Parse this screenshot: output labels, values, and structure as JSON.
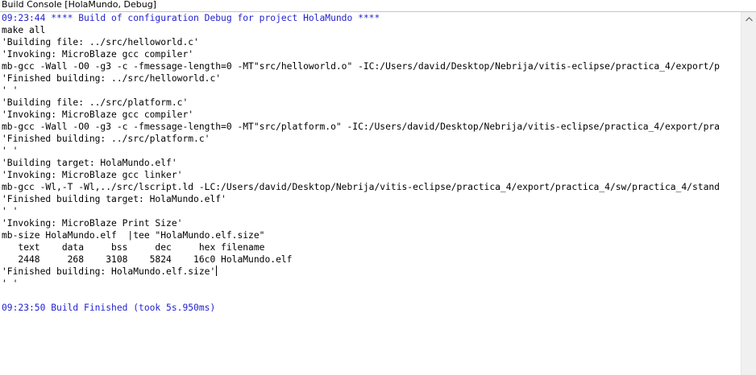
{
  "window": {
    "title": "Build Console [HolaMundo, Debug]"
  },
  "colors": {
    "info_text": "#1f1fd0",
    "normal_text": "#000000",
    "background": "#ffffff"
  },
  "console": {
    "lines": [
      {
        "text": "09:23:44 **** Build of configuration Debug for project HolaMundo ****",
        "type": "info"
      },
      {
        "text": "make all",
        "type": "normal"
      },
      {
        "text": "'Building file: ../src/helloworld.c'",
        "type": "normal"
      },
      {
        "text": "'Invoking: MicroBlaze gcc compiler'",
        "type": "normal"
      },
      {
        "text": "mb-gcc -Wall -O0 -g3 -c -fmessage-length=0 -MT\"src/helloworld.o\" -IC:/Users/david/Desktop/Nebrija/vitis-eclipse/practica_4/export/p",
        "type": "normal"
      },
      {
        "text": "'Finished building: ../src/helloworld.c'",
        "type": "normal"
      },
      {
        "text": "' '",
        "type": "normal"
      },
      {
        "text": "'Building file: ../src/platform.c'",
        "type": "normal"
      },
      {
        "text": "'Invoking: MicroBlaze gcc compiler'",
        "type": "normal"
      },
      {
        "text": "mb-gcc -Wall -O0 -g3 -c -fmessage-length=0 -MT\"src/platform.o\" -IC:/Users/david/Desktop/Nebrija/vitis-eclipse/practica_4/export/pra",
        "type": "normal"
      },
      {
        "text": "'Finished building: ../src/platform.c'",
        "type": "normal"
      },
      {
        "text": "' '",
        "type": "normal"
      },
      {
        "text": "'Building target: HolaMundo.elf'",
        "type": "normal"
      },
      {
        "text": "'Invoking: MicroBlaze gcc linker'",
        "type": "normal"
      },
      {
        "text": "mb-gcc -Wl,-T -Wl,../src/lscript.ld -LC:/Users/david/Desktop/Nebrija/vitis-eclipse/practica_4/export/practica_4/sw/practica_4/stand",
        "type": "normal"
      },
      {
        "text": "'Finished building target: HolaMundo.elf'",
        "type": "normal"
      },
      {
        "text": "' '",
        "type": "normal"
      },
      {
        "text": "'Invoking: MicroBlaze Print Size'",
        "type": "normal"
      },
      {
        "text": "mb-size HolaMundo.elf  |tee \"HolaMundo.elf.size\"",
        "type": "normal"
      },
      {
        "text": "   text    data     bss     dec     hex filename",
        "type": "normal"
      },
      {
        "text": "   2448     268    3108    5824    16c0 HolaMundo.elf",
        "type": "normal"
      },
      {
        "text": "'Finished building: HolaMundo.elf.size'",
        "type": "normal",
        "caret": true
      },
      {
        "text": "' '",
        "type": "normal"
      },
      {
        "text": "",
        "type": "normal"
      },
      {
        "text": "09:23:50 Build Finished (took 5s.950ms)",
        "type": "info"
      }
    ]
  },
  "scrollbar": {
    "up_icon": "chevron-up-icon"
  }
}
